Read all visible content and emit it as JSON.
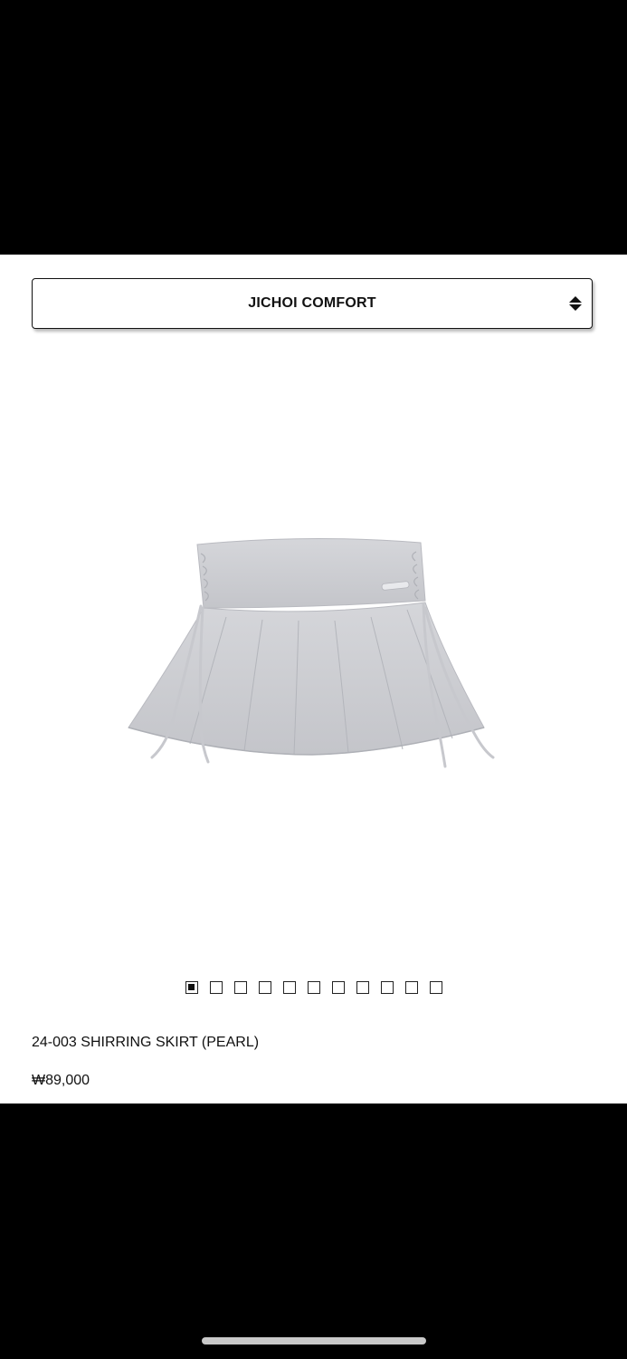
{
  "selector": {
    "label": "JICHOI COMFORT",
    "icon": "sort-arrows-icon"
  },
  "product": {
    "image_subject": "skirt-image",
    "name": "24-003 SHIRRING SKIRT (PEARL)",
    "price": "₩89,000",
    "color": "#c9cace"
  },
  "gallery": {
    "count": 11,
    "active_index": 0
  }
}
